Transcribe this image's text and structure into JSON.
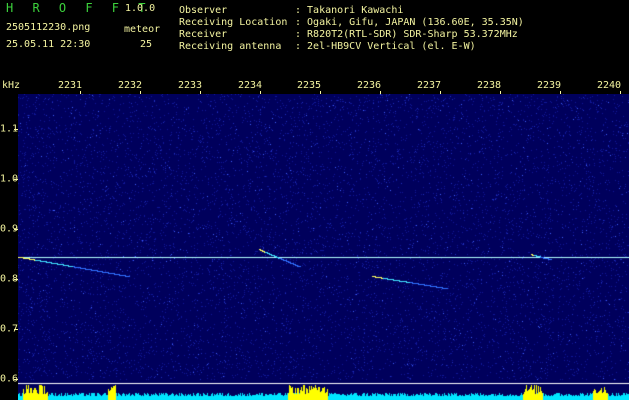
{
  "header": {
    "app_name": "H R O F F T",
    "version": "1.0.0",
    "filename": "2505112230.png",
    "meteor_label": "meteor",
    "datetime": "25.05.11 22:30",
    "meteor_count": "25",
    "info": [
      {
        "key": "Observer",
        "value": ": Takanori Kawachi"
      },
      {
        "key": "Receiving Location",
        "value": ": Ogaki, Gifu, JAPAN (136.60E, 35.35N)"
      },
      {
        "key": "Receiver",
        "value": ": R820T2(RTL-SDR) SDR-Sharp 53.372MHz"
      },
      {
        "key": "Receiving antenna",
        "value": ": 2el-HB9CV Vertical (el. E-W)"
      }
    ]
  },
  "axis": {
    "unit": "kHz",
    "time_ticks": [
      "2231",
      "2232",
      "2233",
      "2234",
      "2235",
      "2236",
      "2237",
      "2238",
      "2239",
      "2240"
    ],
    "freq_ticks": [
      "1.1",
      "1.0",
      "0.9",
      "0.8",
      "0.7",
      "0.6"
    ]
  },
  "colors": {
    "background": "#00005c",
    "text": "#f4f4a0",
    "title_green": "#3cd23c",
    "carrier": "#b0ffff",
    "baseline": "#ffffff",
    "bars_cyan": "#00e5ff",
    "bars_yellow": "#ffff00"
  },
  "spectrogram": {
    "freq_range_khz": [
      0.585,
      1.215
    ],
    "time_range": [
      "22:30",
      "22:40"
    ],
    "carrier_khz": 0.88,
    "echoes": [
      {
        "t_start_min": 0.0,
        "t_end_min": 1.8,
        "f_start_khz": 0.88,
        "f_end_khz": 0.84
      },
      {
        "t_start_min": 3.95,
        "t_end_min": 4.6,
        "f_start_khz": 0.895,
        "f_end_khz": 0.86
      },
      {
        "t_start_min": 5.8,
        "t_end_min": 7.0,
        "f_start_khz": 0.84,
        "f_end_khz": 0.815
      },
      {
        "t_start_min": 8.4,
        "t_end_min": 8.7,
        "f_start_khz": 0.885,
        "f_end_khz": 0.875
      }
    ]
  }
}
